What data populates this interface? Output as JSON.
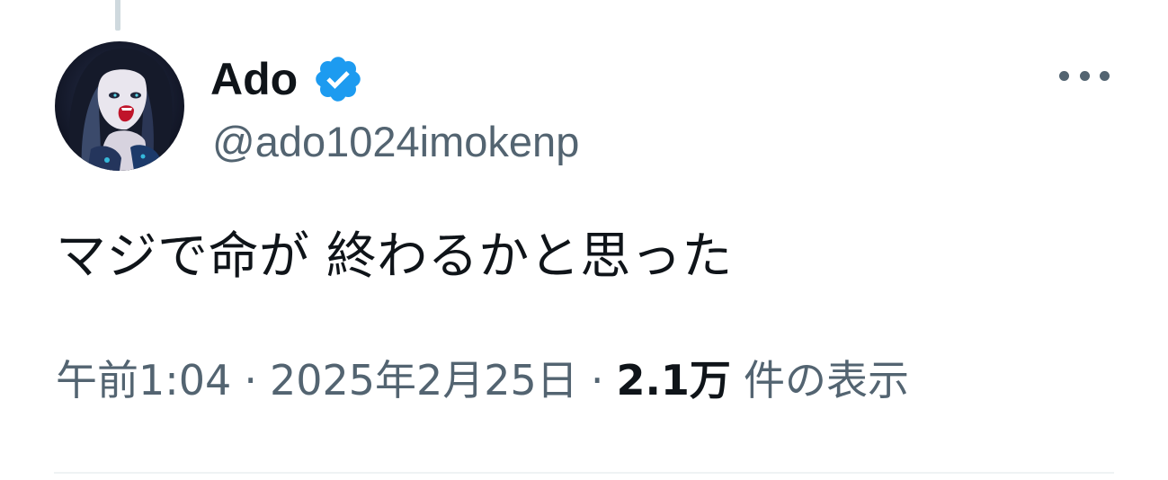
{
  "tweet": {
    "author": {
      "display_name": "Ado",
      "handle": "@ado1024imokenp",
      "verified": true,
      "verified_color": "#1d9bf0",
      "avatar_icon": "avatar-illustration"
    },
    "text": "マジで命が 終わるかと思った",
    "time": "午前1:04",
    "date": "2025年2月25日",
    "separator": "·",
    "views_count": "2.1万",
    "views_label": "件の表示",
    "more_icon": "more-horizontal-icon"
  },
  "colors": {
    "primary_text": "#0f1419",
    "secondary_text": "#536471",
    "verified_blue": "#1d9bf0",
    "divider": "#eff3f4",
    "thread_line": "#cfd9de"
  }
}
